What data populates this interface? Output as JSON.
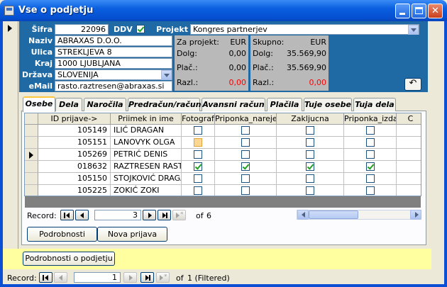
{
  "window": {
    "title": "Vse o podjetju"
  },
  "header": {
    "sifra_label": "Šifra",
    "sifra_value": "22096",
    "ddv_label": "DDV",
    "projekt_label": "Projekt",
    "projekt_value": "Kongres partnerjev",
    "naziv_label": "Naziv",
    "naziv_value": "ABRAXAS D.O.O.",
    "ulica_label": "Ulica",
    "ulica_value": "STREKLJEVA 8",
    "kraj_label": "Kraj",
    "kraj_value": "1000 LJUBLJANA",
    "drzava_label": "Država",
    "drzava_value": "SLOVENIJA",
    "email_label": "eMail",
    "email_value": "rasto.raztresen@abraxas.si"
  },
  "projekt_panel": {
    "title": "Za projekt:",
    "currency": "EUR",
    "dolg_label": "Dolg:",
    "dolg_value": "0,00",
    "plac_label": "Plač.:",
    "plac_value": "0,00",
    "razl_label": "Razl.:",
    "razl_value": "0,00"
  },
  "skupno_panel": {
    "title": "Skupno:",
    "currency": "EUR",
    "dolg_label": "Dolg:",
    "dolg_value": "35.569,90",
    "plac_label": "Plač.:",
    "plac_value": "35.569,90",
    "razl_label": "Razl.:",
    "razl_value": "0,00"
  },
  "tabs": [
    {
      "label": "Osebe"
    },
    {
      "label": "Dela"
    },
    {
      "label": "Naročila"
    },
    {
      "label": "Predračun/račun"
    },
    {
      "label": "Avansni račun"
    },
    {
      "label": "Plačila"
    },
    {
      "label": "Tuje osebe"
    },
    {
      "label": "Tuja dela"
    }
  ],
  "grid": {
    "columns": [
      "ID prijave->",
      "Priimek in ime",
      "Fotograf",
      "Priponka_narejen",
      "Zakljucna",
      "Priponka_izdar",
      "C"
    ],
    "rows": [
      {
        "id": "105149",
        "name": "ILIĆ DRAGAN",
        "fotograf": false,
        "priponka_narejena": false,
        "zakljucna": false,
        "priponka_izdana": false
      },
      {
        "id": "105151",
        "name": "LANOVYK OLGA",
        "fotograf": false,
        "priponka_narejena": false,
        "zakljucna": false,
        "priponka_izdana": false
      },
      {
        "id": "105269",
        "name": "PETRIĆ DENIS",
        "fotograf": false,
        "priponka_narejena": false,
        "zakljucna": false,
        "priponka_izdana": false
      },
      {
        "id": "018632",
        "name": "RAZTRESEN RASTO",
        "fotograf": true,
        "priponka_narejena": true,
        "zakljucna": true,
        "priponka_izdana": true
      },
      {
        "id": "105150",
        "name": "STOJKOVIĆ DRAGAN",
        "fotograf": false,
        "priponka_narejena": false,
        "zakljucna": false,
        "priponka_izdana": false
      },
      {
        "id": "105225",
        "name": "ZOKIĆ ZOKI",
        "fotograf": false,
        "priponka_narejena": false,
        "zakljucna": false,
        "priponka_izdana": false
      }
    ]
  },
  "subnav": {
    "record_label": "Record:",
    "current": "3",
    "of_label": "of",
    "total": "6"
  },
  "buttons": {
    "podrobnosti": "Podrobnosti",
    "nova_prijava": "Nova prijava",
    "podrobnosti_podjetju": "Podrobnosti o podjetju"
  },
  "mainnav": {
    "record_label": "Record:",
    "current": "1",
    "of_label": "of",
    "total": "1 (Filtered)"
  }
}
